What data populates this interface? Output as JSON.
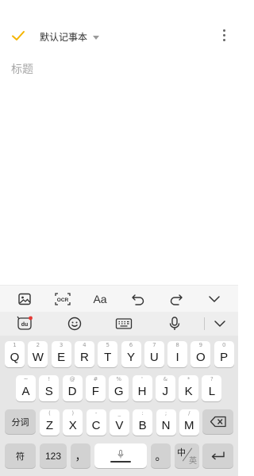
{
  "header": {
    "check_icon": "check-icon",
    "notebook_label": "默认记事本",
    "notebook_caret_icon": "caret-down-icon",
    "more_icon": "more-vertical-icon",
    "accent_color": "#f5b400"
  },
  "editor": {
    "title_placeholder": "标题",
    "title_value": ""
  },
  "toolbar": {
    "items": [
      "image-icon",
      "ocr-icon",
      "text-format-icon",
      "undo-icon",
      "redo-icon",
      "collapse-icon"
    ],
    "ocr_label": "OCR",
    "format_label": "Aa"
  },
  "keyboard": {
    "top_row": [
      "ime-logo-icon",
      "emoji-icon",
      "keyboard-icon",
      "voice-icon",
      "hide-keyboard-icon"
    ],
    "row1": [
      {
        "main": "Q",
        "sub": "1"
      },
      {
        "main": "W",
        "sub": "2"
      },
      {
        "main": "E",
        "sub": "3"
      },
      {
        "main": "R",
        "sub": "4"
      },
      {
        "main": "T",
        "sub": "5"
      },
      {
        "main": "Y",
        "sub": "6"
      },
      {
        "main": "U",
        "sub": "7"
      },
      {
        "main": "I",
        "sub": "8"
      },
      {
        "main": "O",
        "sub": "9"
      },
      {
        "main": "P",
        "sub": "0"
      }
    ],
    "row2": [
      {
        "main": "A",
        "sub": "~"
      },
      {
        "main": "S",
        "sub": "!"
      },
      {
        "main": "D",
        "sub": "@"
      },
      {
        "main": "F",
        "sub": "#"
      },
      {
        "main": "G",
        "sub": "%"
      },
      {
        "main": "H",
        "sub": "'"
      },
      {
        "main": "J",
        "sub": "&"
      },
      {
        "main": "K",
        "sub": "*"
      },
      {
        "main": "L",
        "sub": "?"
      }
    ],
    "row3": [
      {
        "main": "Z",
        "sub": "("
      },
      {
        "main": "X",
        "sub": ")"
      },
      {
        "main": "C",
        "sub": "-"
      },
      {
        "main": "V",
        "sub": "_"
      },
      {
        "main": "B",
        "sub": ":"
      },
      {
        "main": "N",
        "sub": ";"
      },
      {
        "main": "M",
        "sub": "/"
      }
    ],
    "segment_label": "分词",
    "symbol_label": "符",
    "numbers_label": "123",
    "comma_label": "，",
    "period_label": "。",
    "lang_zh": "中",
    "lang_en": "英",
    "backspace_icon": "backspace-icon",
    "enter_icon": "enter-icon",
    "space_mic_icon": "mic-icon"
  }
}
